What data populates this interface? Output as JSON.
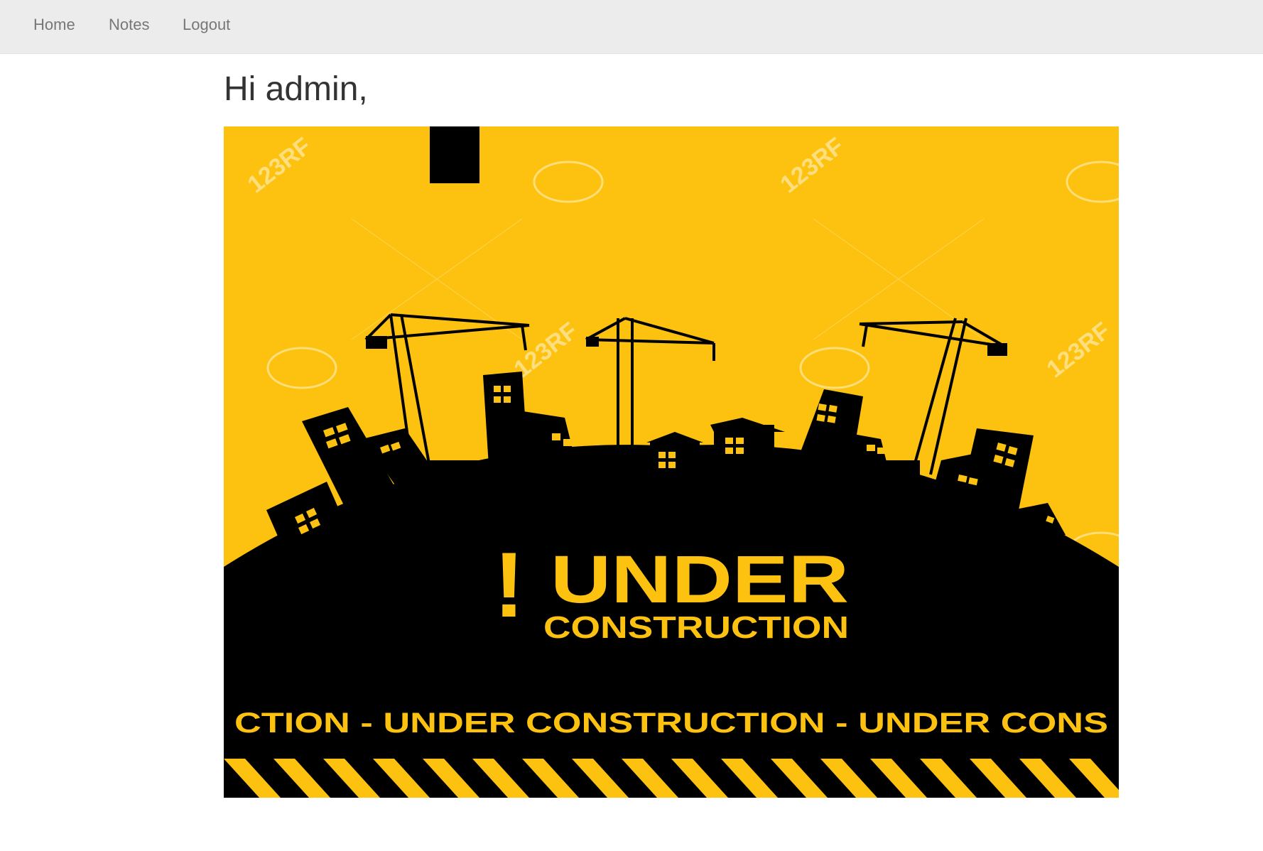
{
  "nav": {
    "items": [
      {
        "label": "Home"
      },
      {
        "label": "Notes"
      },
      {
        "label": "Logout"
      }
    ]
  },
  "greeting": "Hi admin,",
  "banner": {
    "headline_mark": "!",
    "headline_main": "UNDER",
    "headline_sub": "CONSTRUCTION",
    "ribbon_text": "CTION - UNDER  CONSTRUCTION - UNDER  CONS",
    "watermark_text": "123RF",
    "colors": {
      "background": "#fdc10f",
      "silhouette": "#000000",
      "accent_text": "#fdc10f"
    }
  }
}
